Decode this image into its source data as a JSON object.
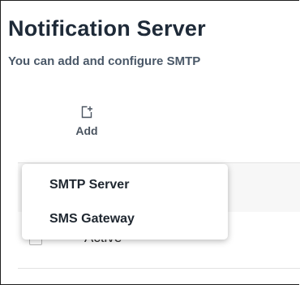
{
  "page": {
    "title": "Notification Server",
    "subtitle": "You can add and configure SMTP"
  },
  "toolbar": {
    "add_label": "Add",
    "add_icon": "add-document-icon"
  },
  "dropdown": {
    "items": [
      {
        "label": "SMTP Server"
      },
      {
        "label": "SMS Gateway"
      }
    ]
  },
  "table": {
    "rows": [
      {
        "status": "Active",
        "checked": false
      }
    ]
  },
  "colors": {
    "title": "#1e2a38",
    "subtitle": "#4a5868",
    "border": "#1f1f1f"
  }
}
